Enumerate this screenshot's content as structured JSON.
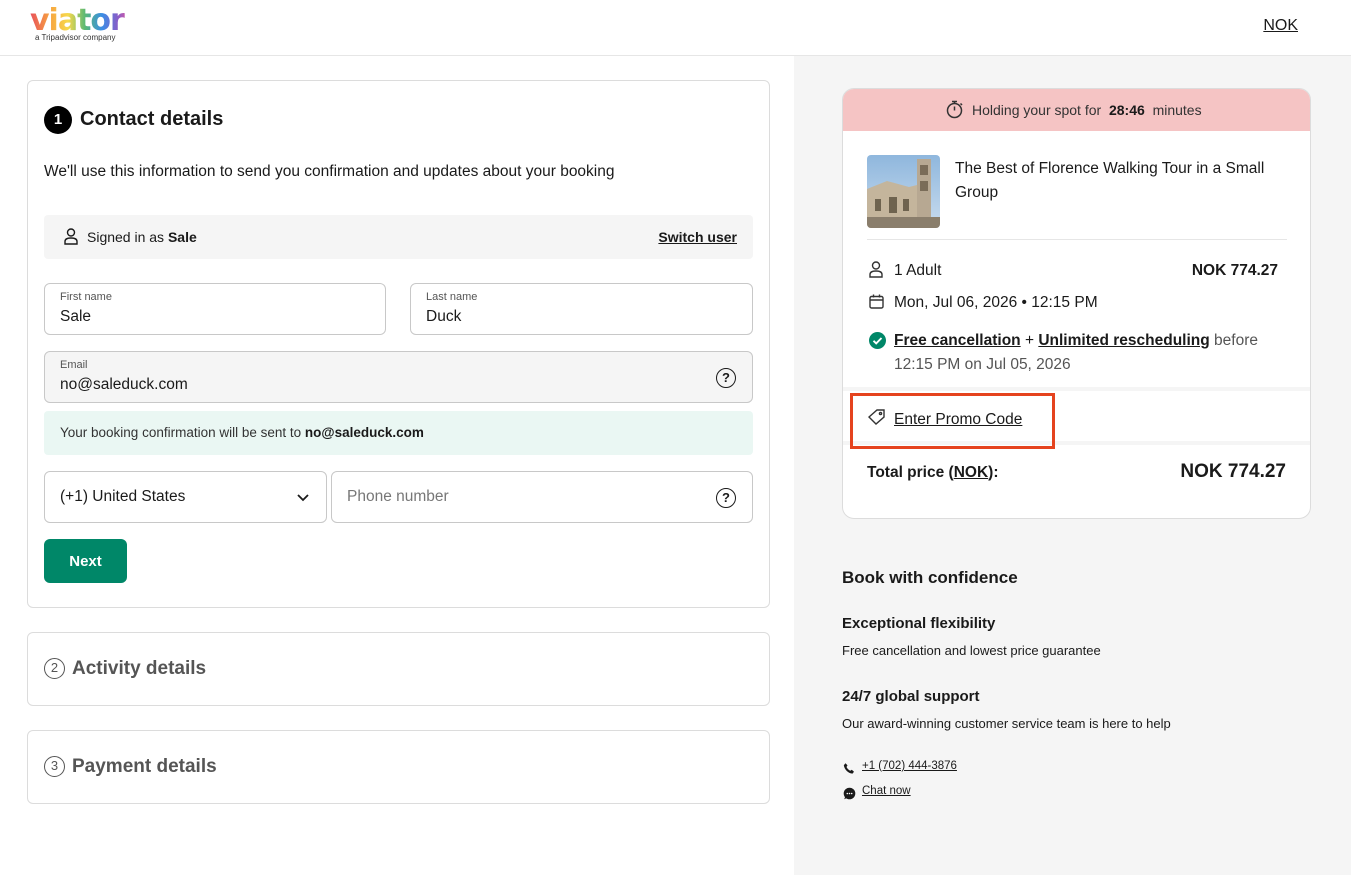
{
  "header": {
    "logo_text": "viator",
    "logo_tagline": "a Tripadvisor company",
    "currency": "NOK"
  },
  "contact": {
    "step_number": "1",
    "title": "Contact details",
    "description": "We'll use this information to send you confirmation and updates about your booking",
    "signed_in_prefix": "Signed in as",
    "signed_in_user": "Sale",
    "switch_user": "Switch user",
    "first_name_label": "First name",
    "first_name_value": "Sale",
    "last_name_label": "Last name",
    "last_name_value": "Duck",
    "email_label": "Email",
    "email_value": "no@saleduck.com",
    "help_glyph": "?",
    "confirmation_prefix": "Your booking confirmation will be sent to",
    "confirmation_email": "no@saleduck.com",
    "country_value": "(+1) United States",
    "phone_placeholder": "Phone number",
    "next_button": "Next"
  },
  "activity": {
    "step_number": "2",
    "title": "Activity details"
  },
  "payment": {
    "step_number": "3",
    "title": "Payment details"
  },
  "summary": {
    "hold_prefix": "Holding your spot for",
    "hold_time": "28:46",
    "hold_suffix": "minutes",
    "tour_title": "The Best of Florence Walking Tour in a Small Group",
    "travelers": "1 Adult",
    "price": "NOK 774.27",
    "date_time": "Mon, Jul 06, 2026 • 12:15 PM",
    "free_cancellation": "Free cancellation",
    "plus": "+",
    "unlimited_rescheduling": "Unlimited rescheduling",
    "before_text": "before 12:15 PM on Jul 05, 2026",
    "promo_link": "Enter Promo Code",
    "total_prefix": "Total price (",
    "total_currency": "NOK",
    "total_suffix": "):",
    "total_value": "NOK 774.27"
  },
  "confidence": {
    "title": "Book with confidence",
    "flex_title": "Exceptional flexibility",
    "flex_desc": "Free cancellation and lowest price guarantee",
    "support_title": "24/7 global support",
    "support_desc": "Our award-winning customer service team is here to help",
    "phone": "+1 (702) 444-3876",
    "chat": "Chat now"
  },
  "colors": {
    "brand_green": "#008768",
    "hold_banner": "#f5c4c4",
    "highlight": "#e5431e",
    "confirm_bg": "#eaf7f3"
  }
}
